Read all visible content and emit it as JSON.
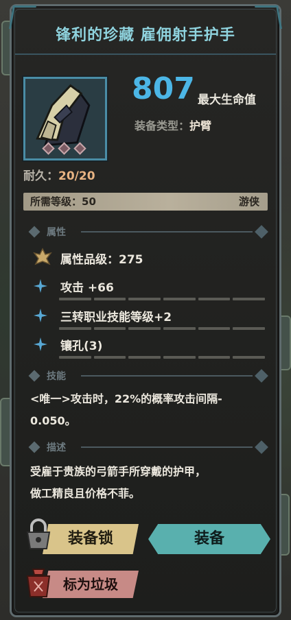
{
  "title": "锋利的珍藏 雇佣射手护手",
  "item": {
    "hp_value": "807",
    "hp_label": "最大生命值",
    "type_label": "装备类型：",
    "type_value": "护臂",
    "durability_label": "耐久：",
    "durability_value": "20/20",
    "required_level_label": "所需等级：50",
    "class_name": "游侠",
    "gem_count": 3
  },
  "attributes_section": {
    "label": "属性",
    "grade": "属性品级：275",
    "rows": [
      "攻击 +66",
      "三转职业技能等级+2",
      "镶孔(3)"
    ]
  },
  "skill_section": {
    "label": "技能",
    "lines": [
      "<唯一>攻击时，22%的概率攻击间隔-",
      "0.050。"
    ]
  },
  "desc_section": {
    "label": "描述",
    "lines": [
      "受雇于贵族的弓箭手所穿戴的护甲，",
      "做工精良且价格不菲。"
    ]
  },
  "buttons": {
    "lock": "装备锁",
    "equip": "装备",
    "trash": "标为垃圾"
  },
  "colors": {
    "title": "#8fd3de",
    "hp": "#4cb6e6",
    "lock_button": "#d9c48a",
    "equip_button": "#59b0ae",
    "trash_button": "#c78a86"
  },
  "icons": [
    "armguard-item-icon",
    "attribute-grade-icon",
    "attribute-star-icon",
    "lock-icon",
    "trash-icon"
  ]
}
